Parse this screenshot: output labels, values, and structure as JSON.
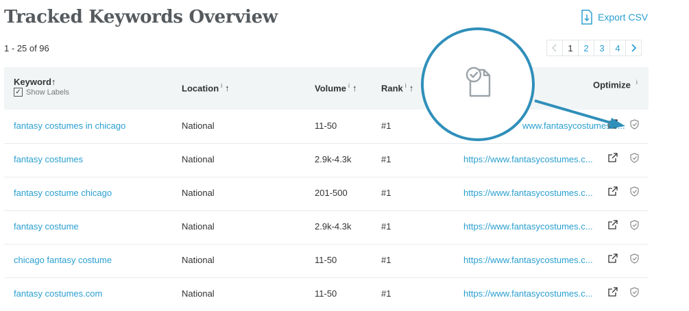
{
  "page": {
    "title": "Tracked Keywords Overview",
    "export_label": "Export CSV",
    "results_count": "1 - 25 of 96"
  },
  "pagination": {
    "prev_icon": "chevron-left-icon",
    "pages": [
      "1",
      "2",
      "3",
      "4"
    ],
    "current_page": "1",
    "next_icon": "chevron-right-icon"
  },
  "table": {
    "columns": {
      "keyword": "Keyword",
      "show_labels": "Show Labels",
      "location": "Location",
      "volume": "Volume",
      "rank": "Rank",
      "optimize": "Optimize"
    },
    "info_marker": "i",
    "sort_marker": "↑",
    "rows": [
      {
        "keyword": "fantasy costumes in chicago",
        "location": "National",
        "volume": "11-50",
        "rank": "#1",
        "url": "www.fantasycostumes.c..."
      },
      {
        "keyword": "fantasy costumes",
        "location": "National",
        "volume": "2.9k-4.3k",
        "rank": "#1",
        "url": "https://www.fantasycostumes.c..."
      },
      {
        "keyword": "fantasy costume chicago",
        "location": "National",
        "volume": "201-500",
        "rank": "#1",
        "url": "https://www.fantasycostumes.c..."
      },
      {
        "keyword": "fantasy costume",
        "location": "National",
        "volume": "2.9k-4.3k",
        "rank": "#1",
        "url": "https://www.fantasycostumes.c..."
      },
      {
        "keyword": "chicago fantasy costume",
        "location": "National",
        "volume": "11-50",
        "rank": "#1",
        "url": "https://www.fantasycostumes.c..."
      },
      {
        "keyword": "fantasy costumes.com",
        "location": "National",
        "volume": "11-50",
        "rank": "#1",
        "url": "https://www.fantasycostumes.c..."
      }
    ]
  },
  "colors": {
    "accent": "#2a9fd0",
    "callout": "#2f8fba",
    "header_bg": "#f1f5f6"
  },
  "icons": {
    "export": "download-file-icon",
    "external": "external-link-icon",
    "optimize": "shield-check-icon",
    "callout": "document-check-icon"
  }
}
